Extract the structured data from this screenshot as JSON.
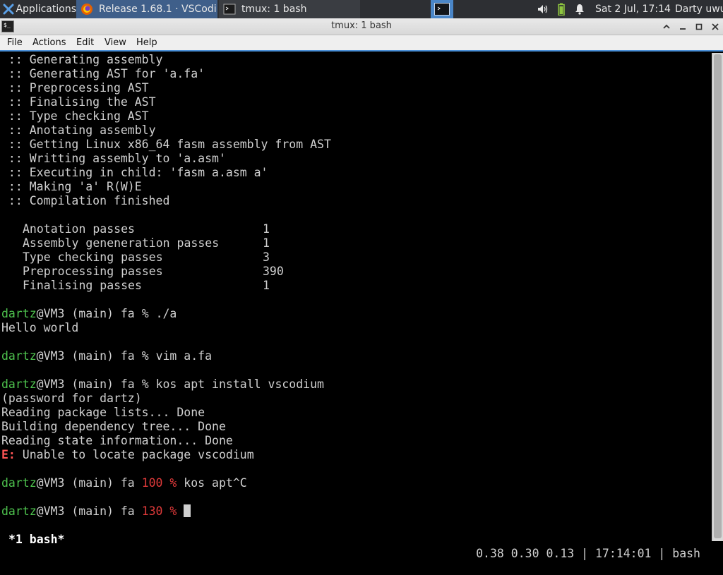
{
  "panel": {
    "apps_label": "Applications",
    "tasks": [
      {
        "label": "Release 1.68.1 · VSCodi...",
        "icon": "firefox-icon"
      },
      {
        "label": "tmux: 1 bash",
        "icon": "terminal-icon"
      }
    ],
    "clock": "Sat  2 Jul, 17:14",
    "user": "Darty uwu"
  },
  "window": {
    "title": "tmux: 1 bash",
    "menu": [
      "File",
      "Actions",
      "Edit",
      "View",
      "Help"
    ]
  },
  "terminal": {
    "log": [
      " :: Generating assembly",
      " :: Generating AST for 'a.fa'",
      " :: Preprocessing AST",
      " :: Finalising the AST",
      " :: Type checking AST",
      " :: Anotating assembly",
      " :: Getting Linux x86_64 fasm assembly from AST",
      " :: Writting assembly to 'a.asm'",
      " :: Executing in child: 'fasm a.asm a'",
      " :: Making 'a' R(W)E",
      " :: Compilation finished"
    ],
    "stats": [
      {
        "name": "Anotation passes",
        "value": "1"
      },
      {
        "name": "Assembly geneneration passes",
        "value": "1"
      },
      {
        "name": "Type checking passes",
        "value": "3"
      },
      {
        "name": "Preprocessing passes",
        "value": "390"
      },
      {
        "name": "Finalising passes",
        "value": "1"
      }
    ],
    "user": "dartz",
    "host_path": "@VM3 (main) fa ",
    "prompt_sym": "% ",
    "cmd1": "./a",
    "out1": "Hello world",
    "cmd2": "vim a.fa",
    "cmd3": "kos apt install vscodium",
    "apt": [
      "(password for dartz)",
      "Reading package lists... Done",
      "Building dependency tree... Done",
      "Reading state information... Done"
    ],
    "err_prefix": "E:",
    "err_msg": " Unable to locate package vscodium",
    "code1": "100 %",
    "cmd4": " kos apt^C",
    "code2": "130 %",
    "status_window": "*1 bash*",
    "status_right": "0.38 0.30 0.13 | 17:14:01 | bash"
  }
}
